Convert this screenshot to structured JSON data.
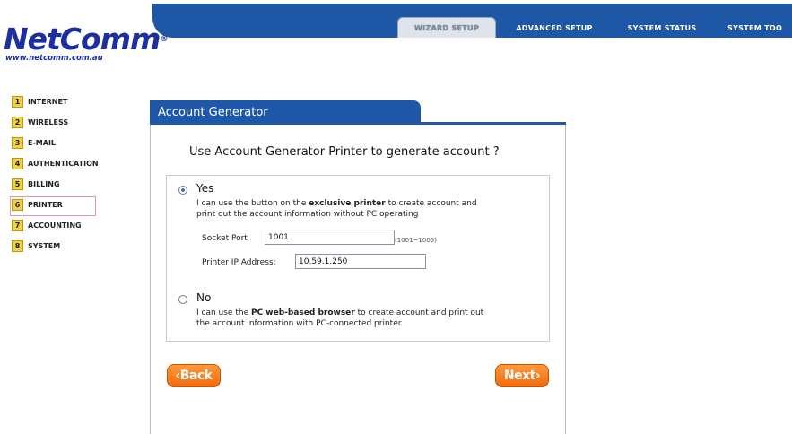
{
  "nav": {
    "tabs": [
      {
        "label": "WIZARD SETUP",
        "active": true
      },
      {
        "label": "ADVANCED SETUP",
        "active": false
      },
      {
        "label": "SYSTEM STATUS",
        "active": false
      },
      {
        "label": "SYSTEM TOO",
        "active": false
      }
    ]
  },
  "logo": {
    "brand": "NetComm",
    "reg": "®",
    "url": "www.netcomm.com.au"
  },
  "menu": {
    "items": [
      {
        "num": "1",
        "label": "INTERNET"
      },
      {
        "num": "2",
        "label": "WIRELESS"
      },
      {
        "num": "3",
        "label": "E-MAIL"
      },
      {
        "num": "4",
        "label": "AUTHENTICATION"
      },
      {
        "num": "5",
        "label": "BILLING"
      },
      {
        "num": "6",
        "label": "PRINTER",
        "selected": true
      },
      {
        "num": "7",
        "label": "ACCOUNTING"
      },
      {
        "num": "8",
        "label": "SYSTEM"
      }
    ]
  },
  "panel": {
    "title": "Account Generator",
    "question": "Use Account Generator Printer to generate account ?",
    "yes": {
      "title": "Yes",
      "desc_1": "I can use the button on the ",
      "desc_bold": "exclusive printer",
      "desc_2": " to create account and",
      "desc_line2": "print out the account information without PC operating",
      "socket_label": "Socket Port",
      "socket_value": "1001",
      "socket_hint": "(1001~1005)",
      "ip_label": "Printer IP Address:",
      "ip_value": "10.59.1.250"
    },
    "no": {
      "title": "No",
      "desc_1": "I can use the ",
      "desc_bold": "PC web-based browser",
      "desc_2": " to create account and print out",
      "desc_line2": "the account information with PC-connected printer"
    },
    "selected_option": "yes",
    "back_label": "Back",
    "next_label": "Next"
  },
  "colors": {
    "nav_blue": "#1d57a6",
    "menu_number_bg": "#f0d24a",
    "button_orange": "#f07a1c",
    "logo_blue": "#1b2fa3"
  }
}
